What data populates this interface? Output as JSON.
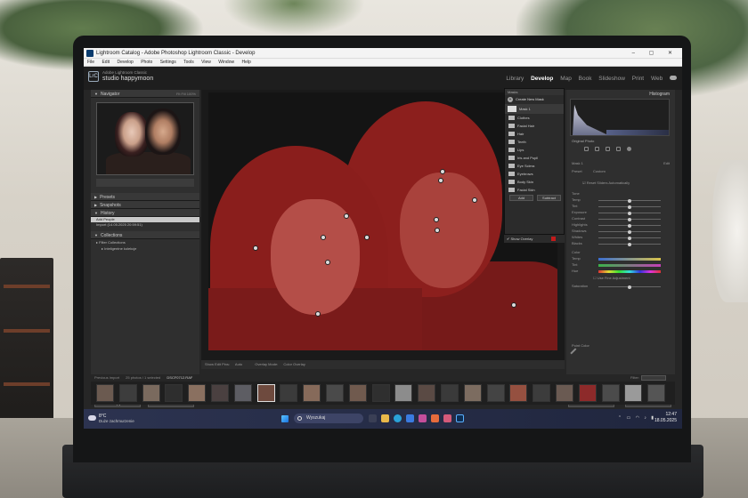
{
  "window": {
    "title": "Lightroom Catalog - Adobe Photoshop Lightroom Classic - Develop",
    "controls": "–  ▢  ✕"
  },
  "menu": [
    "File",
    "Edit",
    "Develop",
    "Photo",
    "Settings",
    "Tools",
    "View",
    "Window",
    "Help"
  ],
  "identity": {
    "catalog_label": "Adobe Lightroom Classic",
    "studio": "studio happymoon",
    "logo": "LrC"
  },
  "modules": [
    "Library",
    "Develop",
    "Map",
    "Book",
    "Slideshow",
    "Print",
    "Web"
  ],
  "active_module": "Develop",
  "left_panel": {
    "navigator": "Navigator",
    "navigator_zoom": "Fit  Fill  100%",
    "presets": "Presets",
    "snapshots": "Snapshots",
    "history": "History",
    "history_items": [
      "Add People",
      "Import (14.05.2025 20:59:51)"
    ],
    "collections": "Collections",
    "collection_items": [
      "Filter Collections",
      "Inteligentne kolekcje"
    ],
    "copy": "Copy...",
    "paste": "Paste"
  },
  "masks_panel": {
    "title": "Masks",
    "create": "Create New Mask",
    "mask_name": "Mask 1",
    "components": [
      "Clothes",
      "Facial Hair",
      "Hair",
      "Teeth",
      "Lips",
      "Iris and Pupil",
      "Eye Sclera",
      "Eyebrows",
      "Body Skin",
      "Facial Skin"
    ],
    "add": "Add",
    "subtract": "Subtract",
    "show_overlay": "Show Overlay"
  },
  "toolbar": {
    "show_edit_pins": "Show Edit Pins:",
    "show_edit_pins_value": "Auto",
    "overlay_mode": "Overlay Mode:",
    "overlay_mode_value": "Color Overlay"
  },
  "right_panel": {
    "histogram": "Histogram",
    "original_photo": "Original Photo",
    "mask_label": "Mask 1",
    "edit": "Edit",
    "preset_label": "Preset",
    "preset_value": "Custom",
    "reset_sliders": "Reset Sliders Automatically",
    "tone": "Tone",
    "sliders": [
      "Temp",
      "Tint",
      "Exposure",
      "Contrast",
      "Highlights",
      "Shadows",
      "Whites",
      "Blacks"
    ],
    "color": "Color",
    "color_sliders": [
      "Temp",
      "Tint",
      "Hue",
      "Saturation"
    ],
    "use_fine": "Use Fine Adjustment",
    "point_color": "Point Color",
    "empty_msg": "Use the Point Color Dropper to add samples.",
    "previous": "Previous",
    "reset": "Reset"
  },
  "filmstrip": {
    "label": "Previous Import",
    "count": "25 photos / 1 selected",
    "filename": "DSCF0712.RAF",
    "filter": "Filter:",
    "selected_index": 7,
    "thumb_count": 25
  },
  "taskbar": {
    "temp": "8°C",
    "condition": "Duże zachmurzenie",
    "search": "Wyszukaj",
    "time": "12:47",
    "date": "18.05.2025"
  },
  "colors": {
    "mask_overlay": "#8a1e1c",
    "accent": "#c9c9c9",
    "taskbar": "#2c3350"
  }
}
